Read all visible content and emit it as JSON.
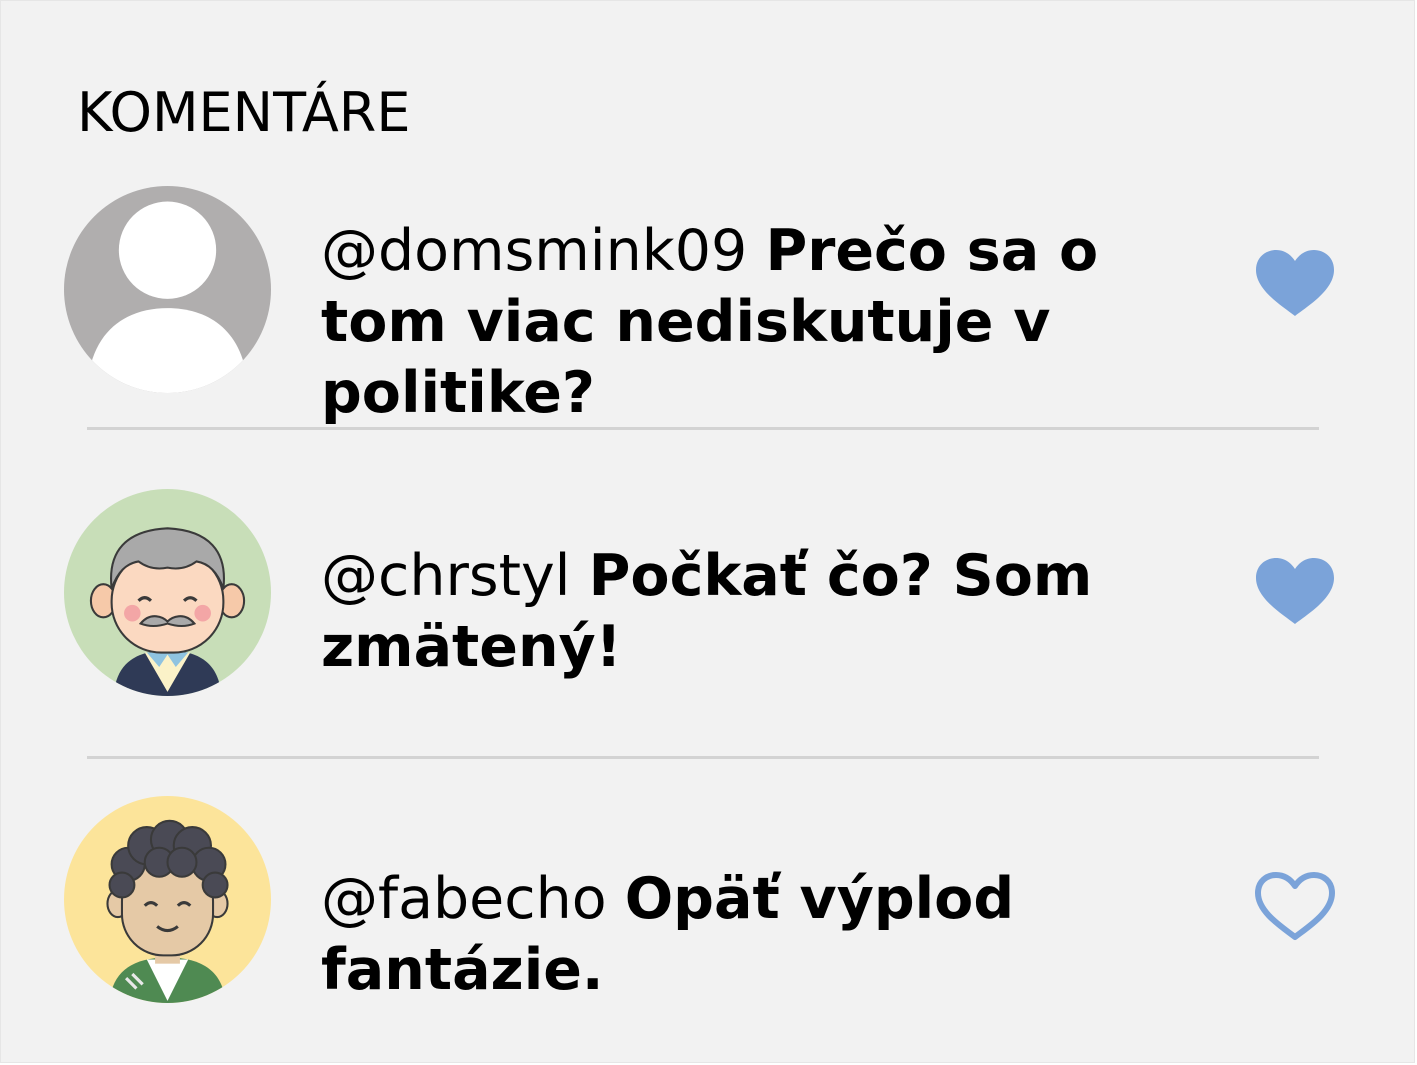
{
  "section": {
    "title": "KOMENTÁRE"
  },
  "comments": [
    {
      "username": "@domsmink09",
      "text": "Prečo sa o tom viac nediskutuje v politike?",
      "avatar": "default-user-avatar",
      "liked": true
    },
    {
      "username": "@chrstyl",
      "text": "Počkať čo? Som zmätený!",
      "avatar": "old-man-avatar",
      "liked": true
    },
    {
      "username": "@fabecho",
      "text": "Opäť výplod fantázie.",
      "avatar": "curly-hair-avatar",
      "liked": false
    }
  ],
  "colors": {
    "background": "#f2f2f2",
    "divider": "#d3d3d3",
    "heart": "#7ba3d9",
    "avatar_default_bg": "#b0aeae",
    "avatar_green_bg": "#c8deb8",
    "avatar_yellow_bg": "#fce49a"
  }
}
